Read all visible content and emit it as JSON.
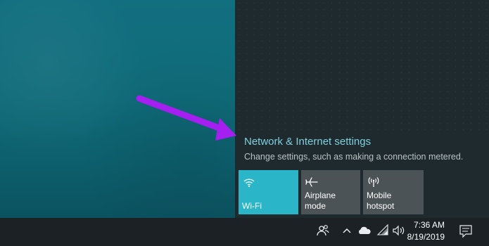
{
  "network": {
    "link_label": "Network & Internet settings",
    "description": "Change settings, such as making a connection metered."
  },
  "quick_actions": [
    {
      "label": "Wi-Fi",
      "icon": "wifi-icon",
      "active": true,
      "color": "#2ab5c8"
    },
    {
      "label": "Airplane mode",
      "icon": "airplane-icon",
      "active": false,
      "color": "#4b5356"
    },
    {
      "label": "Mobile\nhotspot",
      "icon": "hotspot-icon",
      "active": false,
      "color": "#4b5356"
    }
  ],
  "taskbar": {
    "time": "7:36 AM",
    "date": "8/19/2019",
    "tray_icons": [
      "people-icon",
      "chevron-up-icon",
      "onedrive-cloud-icon",
      "wifi-signal-icon",
      "volume-icon",
      "notification-icon"
    ]
  },
  "annotation": {
    "arrow_color": "#a41ff0"
  }
}
